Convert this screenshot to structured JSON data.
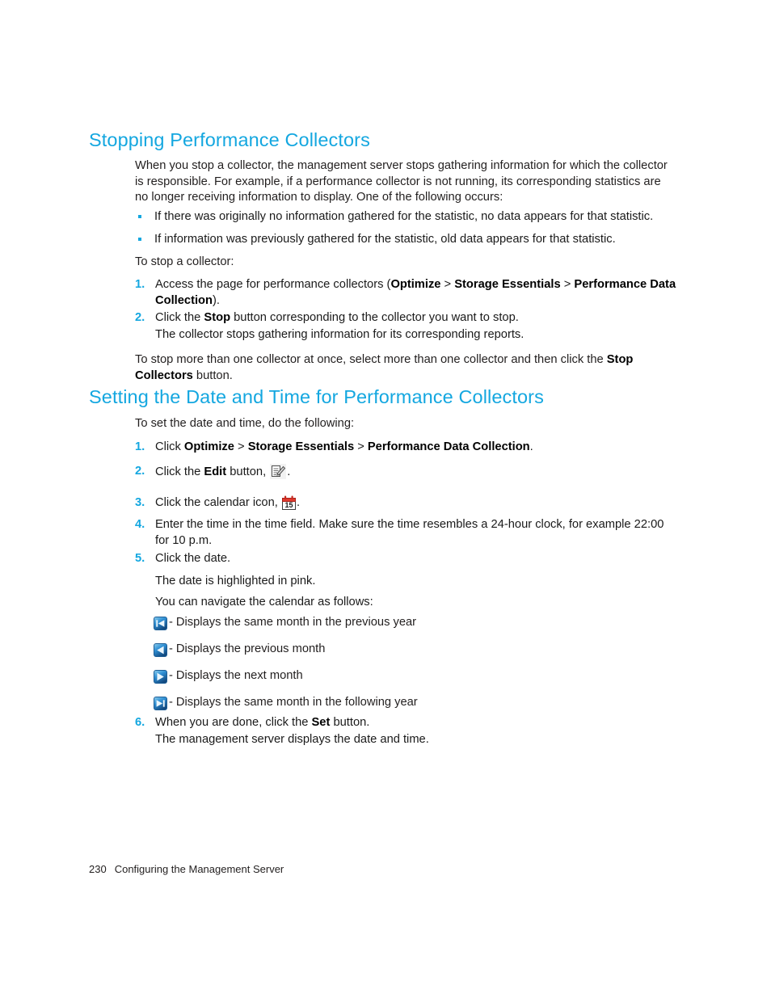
{
  "page": {
    "accent_color": "#14a7e0",
    "text_color": "#221f1f",
    "background": "#ffffff"
  },
  "section_stopping": {
    "heading": "Stopping Performance Collectors",
    "intro": "When you stop a collector, the management server stops gathering information for which the collector is responsible. For example, if a performance collector is not running, its corresponding statistics are no longer receiving information to display. One of the following occurs:",
    "bullets": [
      "If there was originally no information gathered for the statistic, no data appears for that statistic.",
      "If information was previously gathered for the statistic, old data appears for that statistic."
    ],
    "lead_in": "To stop a collector:",
    "steps": [
      {
        "num": "1.",
        "parts": [
          {
            "t": "Access the page for performance collectors (",
            "b": false
          },
          {
            "t": "Optimize",
            "b": true
          },
          {
            "t": " > ",
            "b": false
          },
          {
            "t": "Storage Essentials",
            "b": true
          },
          {
            "t": " > ",
            "b": false
          },
          {
            "t": "Performance Data Collection",
            "b": true
          },
          {
            "t": ").",
            "b": false
          }
        ]
      },
      {
        "num": "2.",
        "parts": [
          {
            "t": "Click the ",
            "b": false
          },
          {
            "t": "Stop",
            "b": true
          },
          {
            "t": " button corresponding to the collector you want to stop.",
            "b": false
          }
        ],
        "sub": "The collector stops gathering information for its corresponding reports."
      }
    ],
    "closing_parts": [
      {
        "t": "To stop more than one collector at once, select more than one collector and then click the ",
        "b": false
      },
      {
        "t": "Stop Collectors",
        "b": true
      },
      {
        "t": " button.",
        "b": false
      }
    ]
  },
  "section_setting": {
    "heading": "Setting the Date and Time for Performance Collectors",
    "lead_in": "To set the date and time, do the following:",
    "steps": [
      {
        "num": "1.",
        "parts": [
          {
            "t": "Click ",
            "b": false
          },
          {
            "t": "Optimize",
            "b": true
          },
          {
            "t": " > ",
            "b": false
          },
          {
            "t": "Storage Essentials",
            "b": true
          },
          {
            "t": " > ",
            "b": false
          },
          {
            "t": "Performance Data Collection",
            "b": true
          },
          {
            "t": ".",
            "b": false
          }
        ]
      },
      {
        "num": "2.",
        "prefix_parts": [
          {
            "t": "Click the ",
            "b": false
          },
          {
            "t": "Edit",
            "b": true
          },
          {
            "t": " button, ",
            "b": false
          }
        ],
        "icon": "edit-icon",
        "suffix": "."
      },
      {
        "num": "3.",
        "prefix_parts": [
          {
            "t": "Click the calendar icon, ",
            "b": false
          }
        ],
        "icon": "calendar-icon",
        "suffix": "."
      },
      {
        "num": "4.",
        "parts": [
          {
            "t": "Enter the time in the time field. Make sure the time resembles a 24-hour clock, for example 22:00 for 10 p.m.",
            "b": false
          }
        ]
      },
      {
        "num": "5.",
        "parts": [
          {
            "t": "Click the date.",
            "b": false
          }
        ],
        "sub": "The date is highlighted in pink.",
        "sub2": "You can navigate the calendar as follows:"
      },
      {
        "num": "6.",
        "parts": [
          {
            "t": "When you are done, click the ",
            "b": false
          },
          {
            "t": "Set",
            "b": true
          },
          {
            "t": " button.",
            "b": false
          }
        ],
        "sub": "The management server displays the date and time."
      }
    ],
    "nav_legend": [
      {
        "icon": "skip-previous-year-icon",
        "dash": "-",
        "label": "Displays the same month in the previous year"
      },
      {
        "icon": "previous-month-icon",
        "dash": "-",
        "label": "Displays the previous month"
      },
      {
        "icon": "next-month-icon",
        "dash": "-",
        "label": "Displays the next month"
      },
      {
        "icon": "skip-next-year-icon",
        "dash": "-",
        "label": "Displays the same month in the following year"
      }
    ]
  },
  "footer": {
    "page_number": "230",
    "title": "Configuring the Management Server"
  }
}
